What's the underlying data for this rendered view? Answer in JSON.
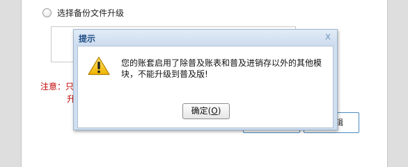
{
  "background": {
    "radio_label": "选择备份文件升级",
    "note_prefix": "注意：只",
    "note_line2": "升",
    "partial_button_text": "辑"
  },
  "dialog": {
    "title": "提示",
    "close_glyph": "x",
    "message": "您的账套启用了除普及账表和普及进销存以外的其他模块，不能升级到普及版!",
    "ok_label_prefix": "确定(",
    "ok_mnemonic": "O",
    "ok_label_suffix": ")",
    "icon": "warning-icon"
  },
  "colors": {
    "note_red": "#c00000",
    "title_blue": "#1f4e85",
    "dialog_frame": "#cfdff0",
    "button_border_blue": "#4a8bc2"
  }
}
